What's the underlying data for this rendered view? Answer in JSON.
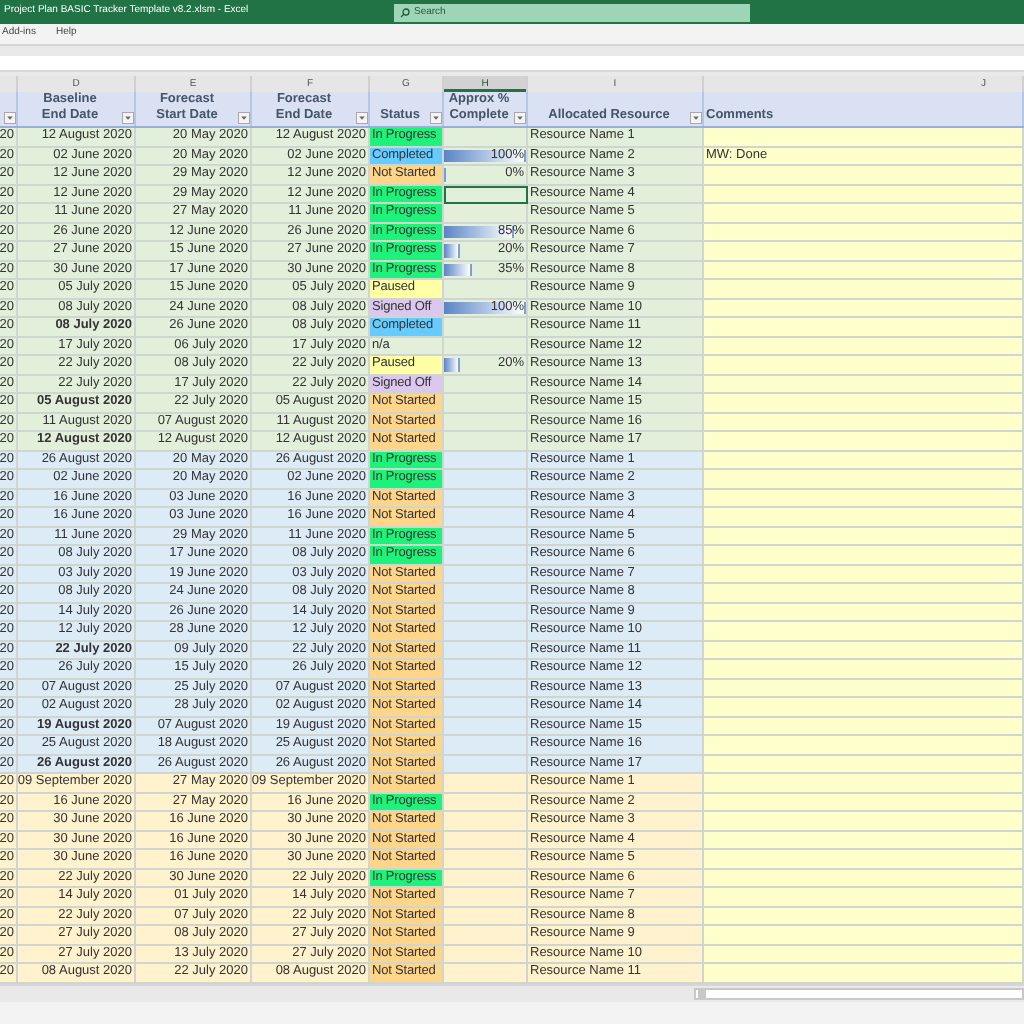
{
  "window": {
    "title": "Project Plan BASIC Tracker Template v8.2.xlsm  -  Excel",
    "search_placeholder": "Search"
  },
  "menu": [
    "Add-ins",
    "Help"
  ],
  "column_letters": [
    {
      "letter": "D",
      "selected": false
    },
    {
      "letter": "E",
      "selected": false
    },
    {
      "letter": "F",
      "selected": false
    },
    {
      "letter": "G",
      "selected": false
    },
    {
      "letter": "H",
      "selected": true
    },
    {
      "letter": "I",
      "selected": false
    },
    {
      "letter": "J",
      "selected": false
    }
  ],
  "headers": [
    {
      "filter": true
    },
    {
      "label": "Baseline\nEnd Date",
      "filter": true
    },
    {
      "label": "Forecast\nStart Date",
      "filter": true
    },
    {
      "label": "Forecast\nEnd Date",
      "filter": true
    },
    {
      "label": "Status",
      "filter": true
    },
    {
      "label": "Approx %\nComplete",
      "filter": true
    },
    {
      "label": "Allocated Resource",
      "filter": true
    },
    {
      "label": "Comments",
      "filter": false
    }
  ],
  "groups": [
    {
      "color": "#e2efda",
      "rows": [
        {
          "column_c": "20",
          "baseline_end": "12 August 2020",
          "baseline_bold": false,
          "forecast_start": "20 May 2020",
          "forecast_end": "12 August 2020",
          "status": {
            "text": "In Progress",
            "color": "#1ef27a"
          },
          "resource": "Resource Name 1",
          "selected": false
        },
        {
          "column_c": "20",
          "baseline_end": "02 June 2020",
          "baseline_bold": false,
          "forecast_start": "20 May 2020",
          "forecast_end": "02 June 2020",
          "status": {
            "text": "Completed",
            "color": "#66ccff"
          },
          "complete": "100%",
          "level": 1,
          "resource": "Resource Name 2",
          "comment": "MW: Done",
          "selected": false
        },
        {
          "column_c": "20",
          "baseline_end": "12 June 2020",
          "baseline_bold": false,
          "forecast_start": "29 May 2020",
          "forecast_end": "12 June 2020",
          "status": {
            "text": "Not Started",
            "color": "#ffd58a"
          },
          "complete": "0%",
          "level": 0,
          "resource": "Resource Name 3",
          "selected": false
        },
        {
          "column_c": "20",
          "baseline_end": "12 June 2020",
          "baseline_bold": false,
          "forecast_start": "29 May 2020",
          "forecast_end": "12 June 2020",
          "status": {
            "text": "In Progress",
            "color": "#1ef27a"
          },
          "resource": "Resource Name 4",
          "selected": true
        },
        {
          "column_c": "20",
          "baseline_end": "11 June 2020",
          "baseline_bold": false,
          "forecast_start": "27 May 2020",
          "forecast_end": "11 June 2020",
          "status": {
            "text": "In Progress",
            "color": "#1ef27a"
          },
          "resource": "Resource Name 5",
          "selected": false
        },
        {
          "column_c": "20",
          "baseline_end": "26 June 2020",
          "baseline_bold": false,
          "forecast_start": "12 June 2020",
          "forecast_end": "26 June 2020",
          "status": {
            "text": "In Progress",
            "color": "#1ef27a"
          },
          "complete": "85%",
          "level": 0.85,
          "resource": "Resource Name 6",
          "selected": false
        },
        {
          "column_c": "20",
          "baseline_end": "27 June 2020",
          "baseline_bold": false,
          "forecast_start": "15 June 2020",
          "forecast_end": "27 June 2020",
          "status": {
            "text": "In Progress",
            "color": "#1ef27a"
          },
          "complete": "20%",
          "level": 0.2,
          "resource": "Resource Name 7",
          "selected": false
        },
        {
          "column_c": "20",
          "baseline_end": "30 June 2020",
          "baseline_bold": false,
          "forecast_start": "17 June 2020",
          "forecast_end": "30 June 2020",
          "status": {
            "text": "In Progress",
            "color": "#1ef27a"
          },
          "complete": "35%",
          "level": 0.35,
          "resource": "Resource Name 8",
          "selected": false
        },
        {
          "column_c": "20",
          "baseline_end": "05 July 2020",
          "baseline_bold": false,
          "forecast_start": "15 June 2020",
          "forecast_end": "05 July 2020",
          "status": {
            "text": "Paused",
            "color": "#ffffa6"
          },
          "resource": "Resource Name 9",
          "selected": false
        },
        {
          "column_c": "20",
          "baseline_end": "08 July 2020",
          "baseline_bold": false,
          "forecast_start": "24 June 2020",
          "forecast_end": "08 July 2020",
          "status": {
            "text": "Signed Off",
            "color": "#dcc8ee"
          },
          "complete": "100%",
          "level": 1,
          "resource": "Resource Name 10",
          "selected": false
        },
        {
          "column_c": "20",
          "baseline_end": "08 July 2020",
          "baseline_bold": true,
          "forecast_start": "26 June 2020",
          "forecast_end": "08 July 2020",
          "status": {
            "text": "Completed",
            "color": "#66ccff"
          },
          "resource": "Resource Name 11",
          "selected": false
        },
        {
          "column_c": "20",
          "baseline_end": "17 July 2020",
          "baseline_bold": false,
          "forecast_start": "06 July 2020",
          "forecast_end": "17 July 2020",
          "status": {
            "text": "n/a"
          },
          "resource": "Resource Name 12",
          "selected": false
        },
        {
          "column_c": "20",
          "baseline_end": "22 July 2020",
          "baseline_bold": false,
          "forecast_start": "08 July 2020",
          "forecast_end": "22 July 2020",
          "status": {
            "text": "Paused",
            "color": "#ffffa6"
          },
          "complete": "20%",
          "level": 0.2,
          "resource": "Resource Name 13",
          "selected": false
        },
        {
          "column_c": "20",
          "baseline_end": "22 July 2020",
          "baseline_bold": false,
          "forecast_start": "17 July 2020",
          "forecast_end": "22 July 2020",
          "status": {
            "text": "Signed Off",
            "color": "#dcc8ee"
          },
          "resource": "Resource Name 14",
          "selected": false
        },
        {
          "column_c": "20",
          "baseline_end": "05 August 2020",
          "baseline_bold": true,
          "forecast_start": "22 July 2020",
          "forecast_end": "05 August 2020",
          "status": {
            "text": "Not Started",
            "color": "#ffd58a"
          },
          "resource": "Resource Name 15",
          "selected": false
        },
        {
          "column_c": "20",
          "baseline_end": "11 August 2020",
          "baseline_bold": false,
          "forecast_start": "07 August 2020",
          "forecast_end": "11 August 2020",
          "status": {
            "text": "Not Started",
            "color": "#ffd58a"
          },
          "resource": "Resource Name 16",
          "selected": false
        },
        {
          "column_c": "20",
          "baseline_end": "12 August 2020",
          "baseline_bold": true,
          "forecast_start": "12 August 2020",
          "forecast_end": "12 August 2020",
          "status": {
            "text": "Not Started",
            "color": "#ffd58a"
          },
          "resource": "Resource Name 17",
          "selected": false
        }
      ]
    },
    {
      "color": "#ddebf7",
      "rows": [
        {
          "column_c": "20",
          "baseline_end": "26 August 2020",
          "baseline_bold": false,
          "forecast_start": "20 May 2020",
          "forecast_end": "26 August 2020",
          "status": {
            "text": "In Progress",
            "color": "#1ef27a"
          },
          "resource": "Resource Name 1",
          "selected": false
        },
        {
          "column_c": "20",
          "baseline_end": "02 June 2020",
          "baseline_bold": false,
          "forecast_start": "20 May 2020",
          "forecast_end": "02 June 2020",
          "status": {
            "text": "In Progress",
            "color": "#1ef27a"
          },
          "resource": "Resource Name 2",
          "selected": false
        },
        {
          "column_c": "20",
          "baseline_end": "16 June 2020",
          "baseline_bold": false,
          "forecast_start": "03 June 2020",
          "forecast_end": "16 June 2020",
          "status": {
            "text": "Not Started",
            "color": "#ffd58a"
          },
          "resource": "Resource Name 3",
          "selected": false
        },
        {
          "column_c": "20",
          "baseline_end": "16 June 2020",
          "baseline_bold": false,
          "forecast_start": "03 June 2020",
          "forecast_end": "16 June 2020",
          "status": {
            "text": "Not Started",
            "color": "#ffd58a"
          },
          "resource": "Resource Name 4",
          "selected": false
        },
        {
          "column_c": "20",
          "baseline_end": "11 June 2020",
          "baseline_bold": false,
          "forecast_start": "29 May 2020",
          "forecast_end": "11 June 2020",
          "status": {
            "text": "In Progress",
            "color": "#1ef27a"
          },
          "resource": "Resource Name 5",
          "selected": false
        },
        {
          "column_c": "20",
          "baseline_end": "08 July 2020",
          "baseline_bold": false,
          "forecast_start": "17 June 2020",
          "forecast_end": "08 July 2020",
          "status": {
            "text": "In Progress",
            "color": "#1ef27a"
          },
          "resource": "Resource Name 6",
          "selected": false
        },
        {
          "column_c": "20",
          "baseline_end": "03 July 2020",
          "baseline_bold": false,
          "forecast_start": "19 June 2020",
          "forecast_end": "03 July 2020",
          "status": {
            "text": "Not Started",
            "color": "#ffd58a"
          },
          "resource": "Resource Name 7",
          "selected": false
        },
        {
          "column_c": "20",
          "baseline_end": "08 July 2020",
          "baseline_bold": false,
          "forecast_start": "24 June 2020",
          "forecast_end": "08 July 2020",
          "status": {
            "text": "Not Started",
            "color": "#ffd58a"
          },
          "resource": "Resource Name 8",
          "selected": false
        },
        {
          "column_c": "20",
          "baseline_end": "14 July 2020",
          "baseline_bold": false,
          "forecast_start": "26 June 2020",
          "forecast_end": "14 July 2020",
          "status": {
            "text": "Not Started",
            "color": "#ffd58a"
          },
          "resource": "Resource Name 9",
          "selected": false
        },
        {
          "column_c": "20",
          "baseline_end": "12 July 2020",
          "baseline_bold": false,
          "forecast_start": "28 June 2020",
          "forecast_end": "12 July 2020",
          "status": {
            "text": "Not Started",
            "color": "#ffd58a"
          },
          "resource": "Resource Name 10",
          "selected": false
        },
        {
          "column_c": "20",
          "baseline_end": "22 July 2020",
          "baseline_bold": true,
          "forecast_start": "09 July 2020",
          "forecast_end": "22 July 2020",
          "status": {
            "text": "Not Started",
            "color": "#ffd58a"
          },
          "resource": "Resource Name 11",
          "selected": false
        },
        {
          "column_c": "20",
          "baseline_end": "26 July 2020",
          "baseline_bold": false,
          "forecast_start": "15 July 2020",
          "forecast_end": "26 July 2020",
          "status": {
            "text": "Not Started",
            "color": "#ffd58a"
          },
          "resource": "Resource Name 12",
          "selected": false
        },
        {
          "column_c": "20",
          "baseline_end": "07 August 2020",
          "baseline_bold": false,
          "forecast_start": "25 July 2020",
          "forecast_end": "07 August 2020",
          "status": {
            "text": "Not Started",
            "color": "#ffd58a"
          },
          "resource": "Resource Name 13",
          "selected": false
        },
        {
          "column_c": "20",
          "baseline_end": "02 August 2020",
          "baseline_bold": false,
          "forecast_start": "28 July 2020",
          "forecast_end": "02 August 2020",
          "status": {
            "text": "Not Started",
            "color": "#ffd58a"
          },
          "resource": "Resource Name 14",
          "selected": false
        },
        {
          "column_c": "20",
          "baseline_end": "19 August 2020",
          "baseline_bold": true,
          "forecast_start": "07 August 2020",
          "forecast_end": "19 August 2020",
          "status": {
            "text": "Not Started",
            "color": "#ffd58a"
          },
          "resource": "Resource Name 15",
          "selected": false
        },
        {
          "column_c": "20",
          "baseline_end": "25 August 2020",
          "baseline_bold": false,
          "forecast_start": "18 August 2020",
          "forecast_end": "25 August 2020",
          "status": {
            "text": "Not Started",
            "color": "#ffd58a"
          },
          "resource": "Resource Name 16",
          "selected": false
        },
        {
          "column_c": "20",
          "baseline_end": "26 August 2020",
          "baseline_bold": true,
          "forecast_start": "26 August 2020",
          "forecast_end": "26 August 2020",
          "status": {
            "text": "Not Started",
            "color": "#ffd58a"
          },
          "resource": "Resource Name 17",
          "selected": false
        }
      ]
    },
    {
      "color": "#fff2cc",
      "rows": [
        {
          "column_c": "20",
          "baseline_end": "09 September 2020",
          "baseline_bold": false,
          "forecast_start": "27 May 2020",
          "forecast_end": "09 September 2020",
          "status": {
            "text": "Not Started",
            "color": "#ffd58a"
          },
          "resource": "Resource Name 1",
          "selected": false
        },
        {
          "column_c": "20",
          "baseline_end": "16 June 2020",
          "baseline_bold": false,
          "forecast_start": "27 May 2020",
          "forecast_end": "16 June 2020",
          "status": {
            "text": "In Progress",
            "color": "#1ef27a"
          },
          "resource": "Resource Name 2",
          "selected": false
        },
        {
          "column_c": "20",
          "baseline_end": "30 June 2020",
          "baseline_bold": false,
          "forecast_start": "16 June 2020",
          "forecast_end": "30 June 2020",
          "status": {
            "text": "Not Started",
            "color": "#ffd58a"
          },
          "resource": "Resource Name 3",
          "selected": false
        },
        {
          "column_c": "20",
          "baseline_end": "30 June 2020",
          "baseline_bold": false,
          "forecast_start": "16 June 2020",
          "forecast_end": "30 June 2020",
          "status": {
            "text": "Not Started",
            "color": "#ffd58a"
          },
          "resource": "Resource Name 4",
          "selected": false
        },
        {
          "column_c": "20",
          "baseline_end": "30 June 2020",
          "baseline_bold": false,
          "forecast_start": "16 June 2020",
          "forecast_end": "30 June 2020",
          "status": {
            "text": "Not Started",
            "color": "#ffd58a"
          },
          "resource": "Resource Name 5",
          "selected": false
        },
        {
          "column_c": "20",
          "baseline_end": "22 July 2020",
          "baseline_bold": false,
          "forecast_start": "30 June 2020",
          "forecast_end": "22 July 2020",
          "status": {
            "text": "In Progress",
            "color": "#1ef27a"
          },
          "resource": "Resource Name 6",
          "selected": false
        },
        {
          "column_c": "20",
          "baseline_end": "14 July 2020",
          "baseline_bold": false,
          "forecast_start": "01 July 2020",
          "forecast_end": "14 July 2020",
          "status": {
            "text": "Not Started",
            "color": "#ffd58a"
          },
          "resource": "Resource Name 7",
          "selected": false
        },
        {
          "column_c": "20",
          "baseline_end": "22 July 2020",
          "baseline_bold": false,
          "forecast_start": "07 July 2020",
          "forecast_end": "22 July 2020",
          "status": {
            "text": "Not Started",
            "color": "#ffd58a"
          },
          "resource": "Resource Name 8",
          "selected": false
        },
        {
          "column_c": "20",
          "baseline_end": "27 July 2020",
          "baseline_bold": false,
          "forecast_start": "08 July 2020",
          "forecast_end": "27 July 2020",
          "status": {
            "text": "Not Started",
            "color": "#ffd58a"
          },
          "resource": "Resource Name 9",
          "selected": false
        },
        {
          "column_c": "20",
          "baseline_end": "27 July 2020",
          "baseline_bold": false,
          "forecast_start": "13 July 2020",
          "forecast_end": "27 July 2020",
          "status": {
            "text": "Not Started",
            "color": "#ffd58a"
          },
          "resource": "Resource Name 10",
          "selected": false
        },
        {
          "column_c": "20",
          "baseline_end": "08 August 2020",
          "baseline_bold": false,
          "forecast_start": "22 July 2020",
          "forecast_end": "08 August 2020",
          "status": {
            "text": "Not Started",
            "color": "#ffd58a"
          },
          "resource": "Resource Name 11",
          "selected": false
        }
      ]
    }
  ]
}
